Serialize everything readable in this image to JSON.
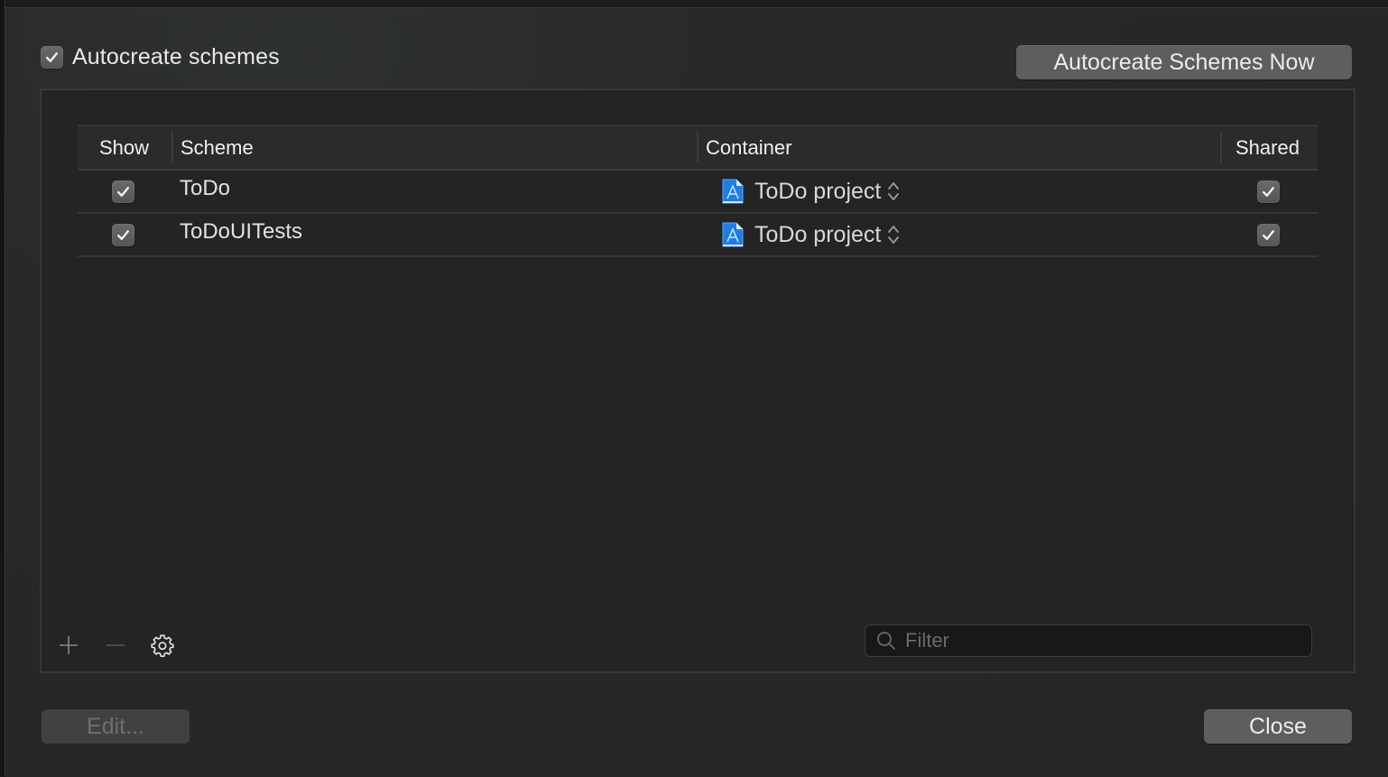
{
  "options": {
    "autocreate_label": "Autocreate schemes",
    "autocreate_checked": true,
    "autocreate_now_button": "Autocreate Schemes Now"
  },
  "table": {
    "columns": [
      "Show",
      "Scheme",
      "Container",
      "Shared"
    ],
    "rows": [
      {
        "show": true,
        "scheme": "ToDo",
        "container": "ToDo project",
        "container_icon": "xcode-project-icon",
        "shared": true
      },
      {
        "show": true,
        "scheme": "ToDoUITests",
        "container": "ToDo project",
        "container_icon": "xcode-project-icon",
        "shared": true
      }
    ]
  },
  "toolbar": {
    "add_icon": "plus-icon",
    "remove_icon": "minus-icon",
    "settings_icon": "gear-icon"
  },
  "filter": {
    "placeholder": "Filter",
    "value": ""
  },
  "footer": {
    "edit_button": "Edit...",
    "close_button": "Close"
  },
  "colors": {
    "background": "#262626",
    "button": "#5e5e5e",
    "project_icon": "#1e7de6"
  }
}
